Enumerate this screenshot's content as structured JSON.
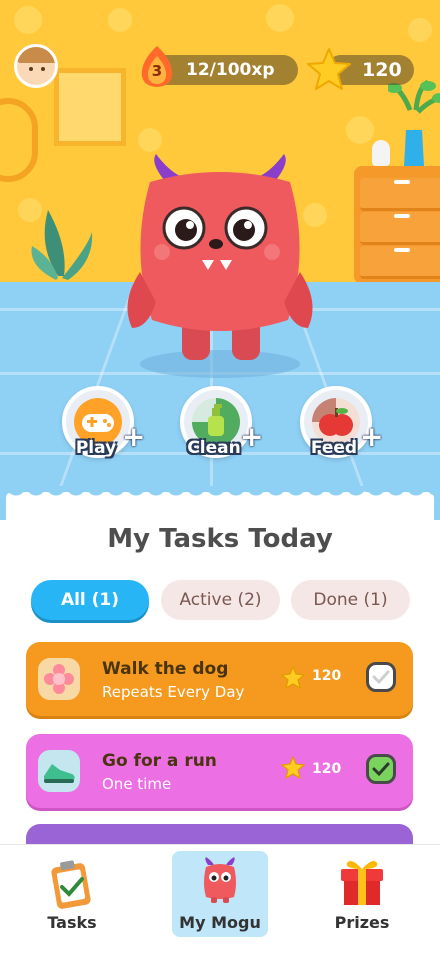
{
  "hud": {
    "level": "3",
    "xp_text": "12/100xp",
    "stars": "120"
  },
  "actions": [
    {
      "label": "Play",
      "icon": "gamepad-icon"
    },
    {
      "label": "Clean",
      "icon": "soap-bottle-icon"
    },
    {
      "label": "Feed",
      "icon": "apple-icon"
    }
  ],
  "tasks_section": {
    "title": "My Tasks Today",
    "filters": [
      {
        "label": "All (1)",
        "selected": true
      },
      {
        "label": "Active (2)",
        "selected": false
      },
      {
        "label": "Done (1)",
        "selected": false
      }
    ],
    "items": [
      {
        "title": "Walk the dog",
        "subtitle": "Repeats Every Day",
        "points": "120",
        "color": "#f59a1e",
        "done": false,
        "icon": "paw-flower-icon"
      },
      {
        "title": "Go for a run",
        "subtitle": "One time",
        "points": "120",
        "color": "#ec70e3",
        "done": true,
        "icon": "sneaker-icon"
      }
    ]
  },
  "nav": [
    {
      "label": "Tasks",
      "icon": "clipboard-check-icon",
      "active": false
    },
    {
      "label": "My Mogu",
      "icon": "mogu-monster-icon",
      "active": true
    },
    {
      "label": "Prizes",
      "icon": "gift-box-icon",
      "active": false
    }
  ],
  "colors": {
    "wall": "#ffc93b",
    "floor": "#8fd0f5",
    "accent_blue": "#27b5f5",
    "monster": "#ef5a5e"
  }
}
